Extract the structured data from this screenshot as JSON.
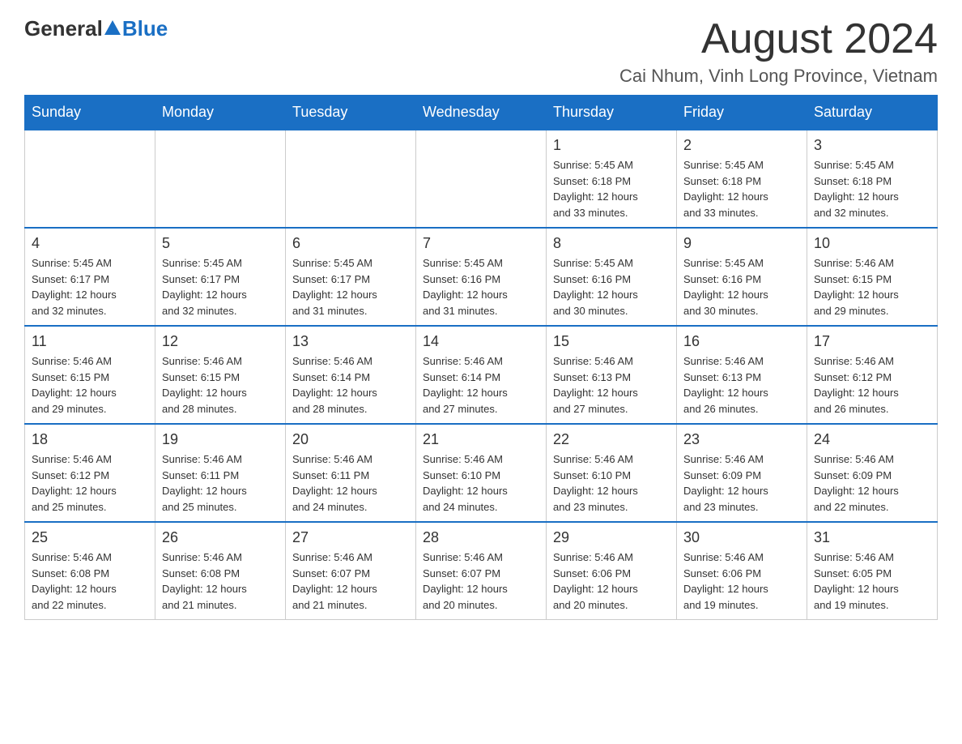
{
  "header": {
    "logo_general": "General",
    "logo_blue": "Blue",
    "month_title": "August 2024",
    "location": "Cai Nhum, Vinh Long Province, Vietnam"
  },
  "days_of_week": [
    "Sunday",
    "Monday",
    "Tuesday",
    "Wednesday",
    "Thursday",
    "Friday",
    "Saturday"
  ],
  "weeks": [
    [
      {
        "day": "",
        "info": ""
      },
      {
        "day": "",
        "info": ""
      },
      {
        "day": "",
        "info": ""
      },
      {
        "day": "",
        "info": ""
      },
      {
        "day": "1",
        "info": "Sunrise: 5:45 AM\nSunset: 6:18 PM\nDaylight: 12 hours\nand 33 minutes."
      },
      {
        "day": "2",
        "info": "Sunrise: 5:45 AM\nSunset: 6:18 PM\nDaylight: 12 hours\nand 33 minutes."
      },
      {
        "day": "3",
        "info": "Sunrise: 5:45 AM\nSunset: 6:18 PM\nDaylight: 12 hours\nand 32 minutes."
      }
    ],
    [
      {
        "day": "4",
        "info": "Sunrise: 5:45 AM\nSunset: 6:17 PM\nDaylight: 12 hours\nand 32 minutes."
      },
      {
        "day": "5",
        "info": "Sunrise: 5:45 AM\nSunset: 6:17 PM\nDaylight: 12 hours\nand 32 minutes."
      },
      {
        "day": "6",
        "info": "Sunrise: 5:45 AM\nSunset: 6:17 PM\nDaylight: 12 hours\nand 31 minutes."
      },
      {
        "day": "7",
        "info": "Sunrise: 5:45 AM\nSunset: 6:16 PM\nDaylight: 12 hours\nand 31 minutes."
      },
      {
        "day": "8",
        "info": "Sunrise: 5:45 AM\nSunset: 6:16 PM\nDaylight: 12 hours\nand 30 minutes."
      },
      {
        "day": "9",
        "info": "Sunrise: 5:45 AM\nSunset: 6:16 PM\nDaylight: 12 hours\nand 30 minutes."
      },
      {
        "day": "10",
        "info": "Sunrise: 5:46 AM\nSunset: 6:15 PM\nDaylight: 12 hours\nand 29 minutes."
      }
    ],
    [
      {
        "day": "11",
        "info": "Sunrise: 5:46 AM\nSunset: 6:15 PM\nDaylight: 12 hours\nand 29 minutes."
      },
      {
        "day": "12",
        "info": "Sunrise: 5:46 AM\nSunset: 6:15 PM\nDaylight: 12 hours\nand 28 minutes."
      },
      {
        "day": "13",
        "info": "Sunrise: 5:46 AM\nSunset: 6:14 PM\nDaylight: 12 hours\nand 28 minutes."
      },
      {
        "day": "14",
        "info": "Sunrise: 5:46 AM\nSunset: 6:14 PM\nDaylight: 12 hours\nand 27 minutes."
      },
      {
        "day": "15",
        "info": "Sunrise: 5:46 AM\nSunset: 6:13 PM\nDaylight: 12 hours\nand 27 minutes."
      },
      {
        "day": "16",
        "info": "Sunrise: 5:46 AM\nSunset: 6:13 PM\nDaylight: 12 hours\nand 26 minutes."
      },
      {
        "day": "17",
        "info": "Sunrise: 5:46 AM\nSunset: 6:12 PM\nDaylight: 12 hours\nand 26 minutes."
      }
    ],
    [
      {
        "day": "18",
        "info": "Sunrise: 5:46 AM\nSunset: 6:12 PM\nDaylight: 12 hours\nand 25 minutes."
      },
      {
        "day": "19",
        "info": "Sunrise: 5:46 AM\nSunset: 6:11 PM\nDaylight: 12 hours\nand 25 minutes."
      },
      {
        "day": "20",
        "info": "Sunrise: 5:46 AM\nSunset: 6:11 PM\nDaylight: 12 hours\nand 24 minutes."
      },
      {
        "day": "21",
        "info": "Sunrise: 5:46 AM\nSunset: 6:10 PM\nDaylight: 12 hours\nand 24 minutes."
      },
      {
        "day": "22",
        "info": "Sunrise: 5:46 AM\nSunset: 6:10 PM\nDaylight: 12 hours\nand 23 minutes."
      },
      {
        "day": "23",
        "info": "Sunrise: 5:46 AM\nSunset: 6:09 PM\nDaylight: 12 hours\nand 23 minutes."
      },
      {
        "day": "24",
        "info": "Sunrise: 5:46 AM\nSunset: 6:09 PM\nDaylight: 12 hours\nand 22 minutes."
      }
    ],
    [
      {
        "day": "25",
        "info": "Sunrise: 5:46 AM\nSunset: 6:08 PM\nDaylight: 12 hours\nand 22 minutes."
      },
      {
        "day": "26",
        "info": "Sunrise: 5:46 AM\nSunset: 6:08 PM\nDaylight: 12 hours\nand 21 minutes."
      },
      {
        "day": "27",
        "info": "Sunrise: 5:46 AM\nSunset: 6:07 PM\nDaylight: 12 hours\nand 21 minutes."
      },
      {
        "day": "28",
        "info": "Sunrise: 5:46 AM\nSunset: 6:07 PM\nDaylight: 12 hours\nand 20 minutes."
      },
      {
        "day": "29",
        "info": "Sunrise: 5:46 AM\nSunset: 6:06 PM\nDaylight: 12 hours\nand 20 minutes."
      },
      {
        "day": "30",
        "info": "Sunrise: 5:46 AM\nSunset: 6:06 PM\nDaylight: 12 hours\nand 19 minutes."
      },
      {
        "day": "31",
        "info": "Sunrise: 5:46 AM\nSunset: 6:05 PM\nDaylight: 12 hours\nand 19 minutes."
      }
    ]
  ]
}
